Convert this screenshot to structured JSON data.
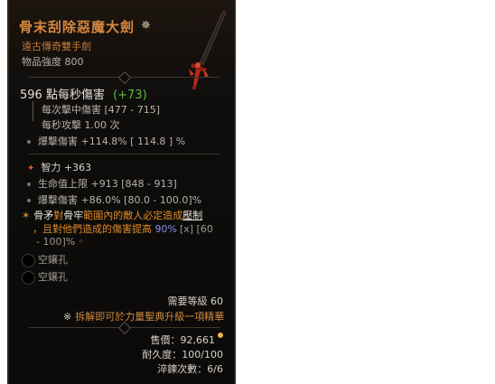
{
  "item": {
    "name": "骨末刮除惡魔大劍",
    "name_mark": "✵",
    "type": "遠古傳奇雙手劍",
    "power": "物品強度 800"
  },
  "damage": {
    "dps": "596 點每秒傷害",
    "dps_delta": "(+73)",
    "per_hit": "每次擊中傷害 [477 - 715]",
    "attack_speed": "每秒攻擊 1.00 次",
    "crit": "爆擊傷害 +114.8%  [ 114.8 ] %"
  },
  "stats": {
    "primary": "智力 +363",
    "life": "生命值上限 +913 [848 - 913]",
    "crit": "爆擊傷害 +86.0% [80.0 - 100.0]%"
  },
  "aspect": {
    "prefix": "骨矛",
    "word1": "對",
    "word2": "骨牢",
    "middle": "範圍內的敵人必定造成",
    "keyword": "壓制",
    "line2a": "，且對他們造成的傷害提高 ",
    "value": "90%",
    "range": "[x] [60",
    "line3": "- 100]%"
  },
  "sockets": [
    "空鑲孔",
    "空鑲孔"
  ],
  "footer": {
    "req_level": "需要等級 60",
    "salvage": "拆解即可於力量聖典升級一項精華",
    "salvage_icon": "※",
    "sell": "售價：92,661",
    "durability": "耐久度：100/100",
    "temper": "淬鍊次數：6/6"
  },
  "colors": {
    "legendary": "#d9893f",
    "green": "#5bbf3c",
    "aspect": "#e08a2a",
    "purple": "#8f8cf0"
  }
}
